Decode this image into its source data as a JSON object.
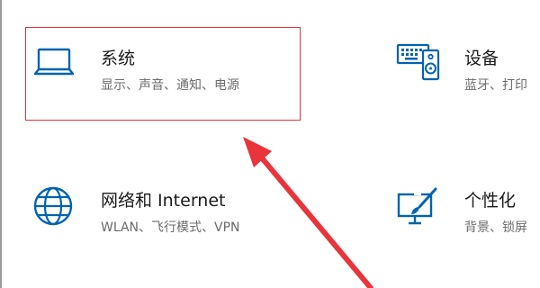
{
  "colors": {
    "accent": "#0063b1",
    "highlight": "#e0353b",
    "arrow": "#e8343a"
  },
  "tiles": [
    {
      "id": "system",
      "title": "系统",
      "description": "显示、声音、通知、电源",
      "icon": "laptop-icon"
    },
    {
      "id": "devices",
      "title": "设备",
      "description": "蓝牙、打印",
      "icon": "keyboard-speaker-icon"
    },
    {
      "id": "network",
      "title": "网络和 Internet",
      "description": "WLAN、飞行模式、VPN",
      "icon": "globe-icon"
    },
    {
      "id": "personalization",
      "title": "个性化",
      "description": "背景、锁屏",
      "icon": "paint-brush-icon"
    }
  ]
}
